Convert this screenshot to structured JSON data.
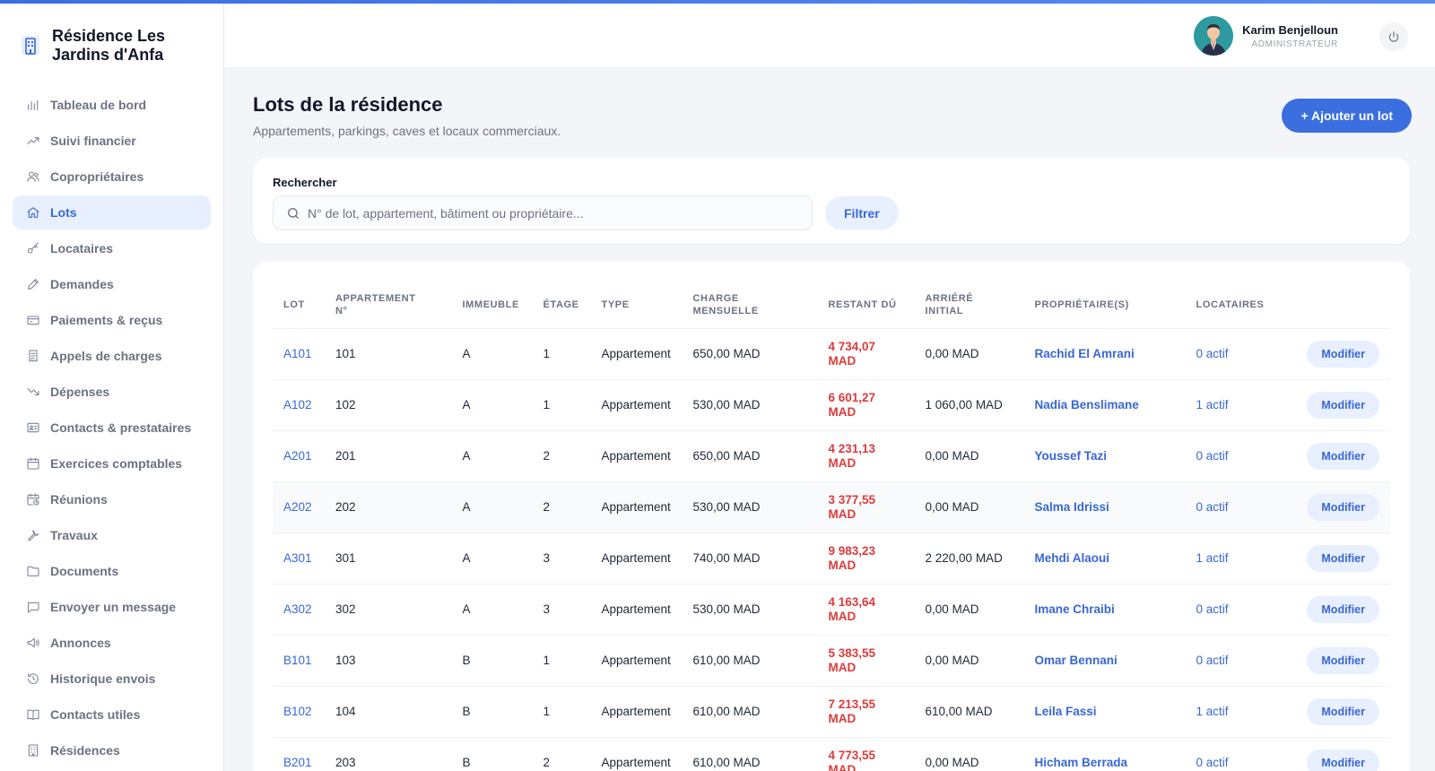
{
  "brand": {
    "name": "Résidence Les Jardins d'Anfa",
    "icon": "building-icon"
  },
  "sidebar": {
    "items": [
      {
        "label": "Tableau de bord",
        "icon": "bar-chart-icon",
        "active": false
      },
      {
        "label": "Suivi financier",
        "icon": "trending-up-icon",
        "active": false
      },
      {
        "label": "Copropriétaires",
        "icon": "users-icon",
        "active": false
      },
      {
        "label": "Lots",
        "icon": "home-icon",
        "active": true
      },
      {
        "label": "Locataires",
        "icon": "key-icon",
        "active": false
      },
      {
        "label": "Demandes",
        "icon": "pencil-icon",
        "active": false
      },
      {
        "label": "Paiements & reçus",
        "icon": "credit-card-icon",
        "active": false
      },
      {
        "label": "Appels de charges",
        "icon": "receipt-icon",
        "active": false
      },
      {
        "label": "Dépenses",
        "icon": "trending-down-icon",
        "active": false
      },
      {
        "label": "Contacts & prestataires",
        "icon": "id-card-icon",
        "active": false
      },
      {
        "label": "Exercices comptables",
        "icon": "calendar-icon",
        "active": false
      },
      {
        "label": "Réunions",
        "icon": "calendar-clock-icon",
        "active": false
      },
      {
        "label": "Travaux",
        "icon": "wrench-icon",
        "active": false
      },
      {
        "label": "Documents",
        "icon": "folder-icon",
        "active": false
      },
      {
        "label": "Envoyer un message",
        "icon": "message-icon",
        "active": false
      },
      {
        "label": "Annonces",
        "icon": "megaphone-icon",
        "active": false
      },
      {
        "label": "Historique envois",
        "icon": "history-icon",
        "active": false
      },
      {
        "label": "Contacts utiles",
        "icon": "book-icon",
        "active": false
      },
      {
        "label": "Résidences",
        "icon": "building-icon",
        "active": false
      }
    ]
  },
  "header": {
    "user_name": "Karim Benjelloun",
    "user_role": "ADMINISTRATEUR"
  },
  "page": {
    "title": "Lots de la résidence",
    "subtitle": "Appartements, parkings, caves et locaux commerciaux.",
    "add_button": "+ Ajouter un lot"
  },
  "search": {
    "label": "Rechercher",
    "placeholder": "N° de lot, appartement, bâtiment ou propriétaire...",
    "filter_button": "Filtrer"
  },
  "table": {
    "columns": [
      "LOT",
      "APPARTEMENT N°",
      "IMMEUBLE",
      "ÉTAGE",
      "TYPE",
      "CHARGE MENSUELLE",
      "RESTANT DÛ",
      "ARRIÉRÉ INITIAL",
      "PROPRIÉTAIRE(S)",
      "LOCATAIRES",
      ""
    ],
    "action_label": "Modifier",
    "rows": [
      {
        "lot": "A101",
        "apt": "101",
        "building": "A",
        "floor": "1",
        "type": "Appartement",
        "charge": "650,00 MAD",
        "due": "4 734,07 MAD",
        "arrears": "0,00 MAD",
        "owner": "Rachid El Amrani",
        "tenants": "0 actif"
      },
      {
        "lot": "A102",
        "apt": "102",
        "building": "A",
        "floor": "1",
        "type": "Appartement",
        "charge": "530,00 MAD",
        "due": "6 601,27 MAD",
        "arrears": "1 060,00 MAD",
        "owner": "Nadia Benslimane",
        "tenants": "1 actif"
      },
      {
        "lot": "A201",
        "apt": "201",
        "building": "A",
        "floor": "2",
        "type": "Appartement",
        "charge": "650,00 MAD",
        "due": "4 231,13 MAD",
        "arrears": "0,00 MAD",
        "owner": "Youssef Tazi",
        "tenants": "0 actif"
      },
      {
        "lot": "A202",
        "apt": "202",
        "building": "A",
        "floor": "2",
        "type": "Appartement",
        "charge": "530,00 MAD",
        "due": "3 377,55 MAD",
        "arrears": "0,00 MAD",
        "owner": "Salma Idrissi",
        "tenants": "0 actif"
      },
      {
        "lot": "A301",
        "apt": "301",
        "building": "A",
        "floor": "3",
        "type": "Appartement",
        "charge": "740,00 MAD",
        "due": "9 983,23 MAD",
        "arrears": "2 220,00 MAD",
        "owner": "Mehdi Alaoui",
        "tenants": "1 actif"
      },
      {
        "lot": "A302",
        "apt": "302",
        "building": "A",
        "floor": "3",
        "type": "Appartement",
        "charge": "530,00 MAD",
        "due": "4 163,64 MAD",
        "arrears": "0,00 MAD",
        "owner": "Imane Chraibi",
        "tenants": "0 actif"
      },
      {
        "lot": "B101",
        "apt": "103",
        "building": "B",
        "floor": "1",
        "type": "Appartement",
        "charge": "610,00 MAD",
        "due": "5 383,55 MAD",
        "arrears": "0,00 MAD",
        "owner": "Omar Bennani",
        "tenants": "0 actif"
      },
      {
        "lot": "B102",
        "apt": "104",
        "building": "B",
        "floor": "1",
        "type": "Appartement",
        "charge": "610,00 MAD",
        "due": "7 213,55 MAD",
        "arrears": "610,00 MAD",
        "owner": "Leila Fassi",
        "tenants": "1 actif"
      },
      {
        "lot": "B201",
        "apt": "203",
        "building": "B",
        "floor": "2",
        "type": "Appartement",
        "charge": "610,00 MAD",
        "due": "4 773,55 MAD",
        "arrears": "0,00 MAD",
        "owner": "Hicham Berrada",
        "tenants": "0 actif"
      }
    ]
  },
  "colors": {
    "accent": "#3b6fe0",
    "due": "#dc3c3c",
    "active_bg": "#e8efff"
  }
}
